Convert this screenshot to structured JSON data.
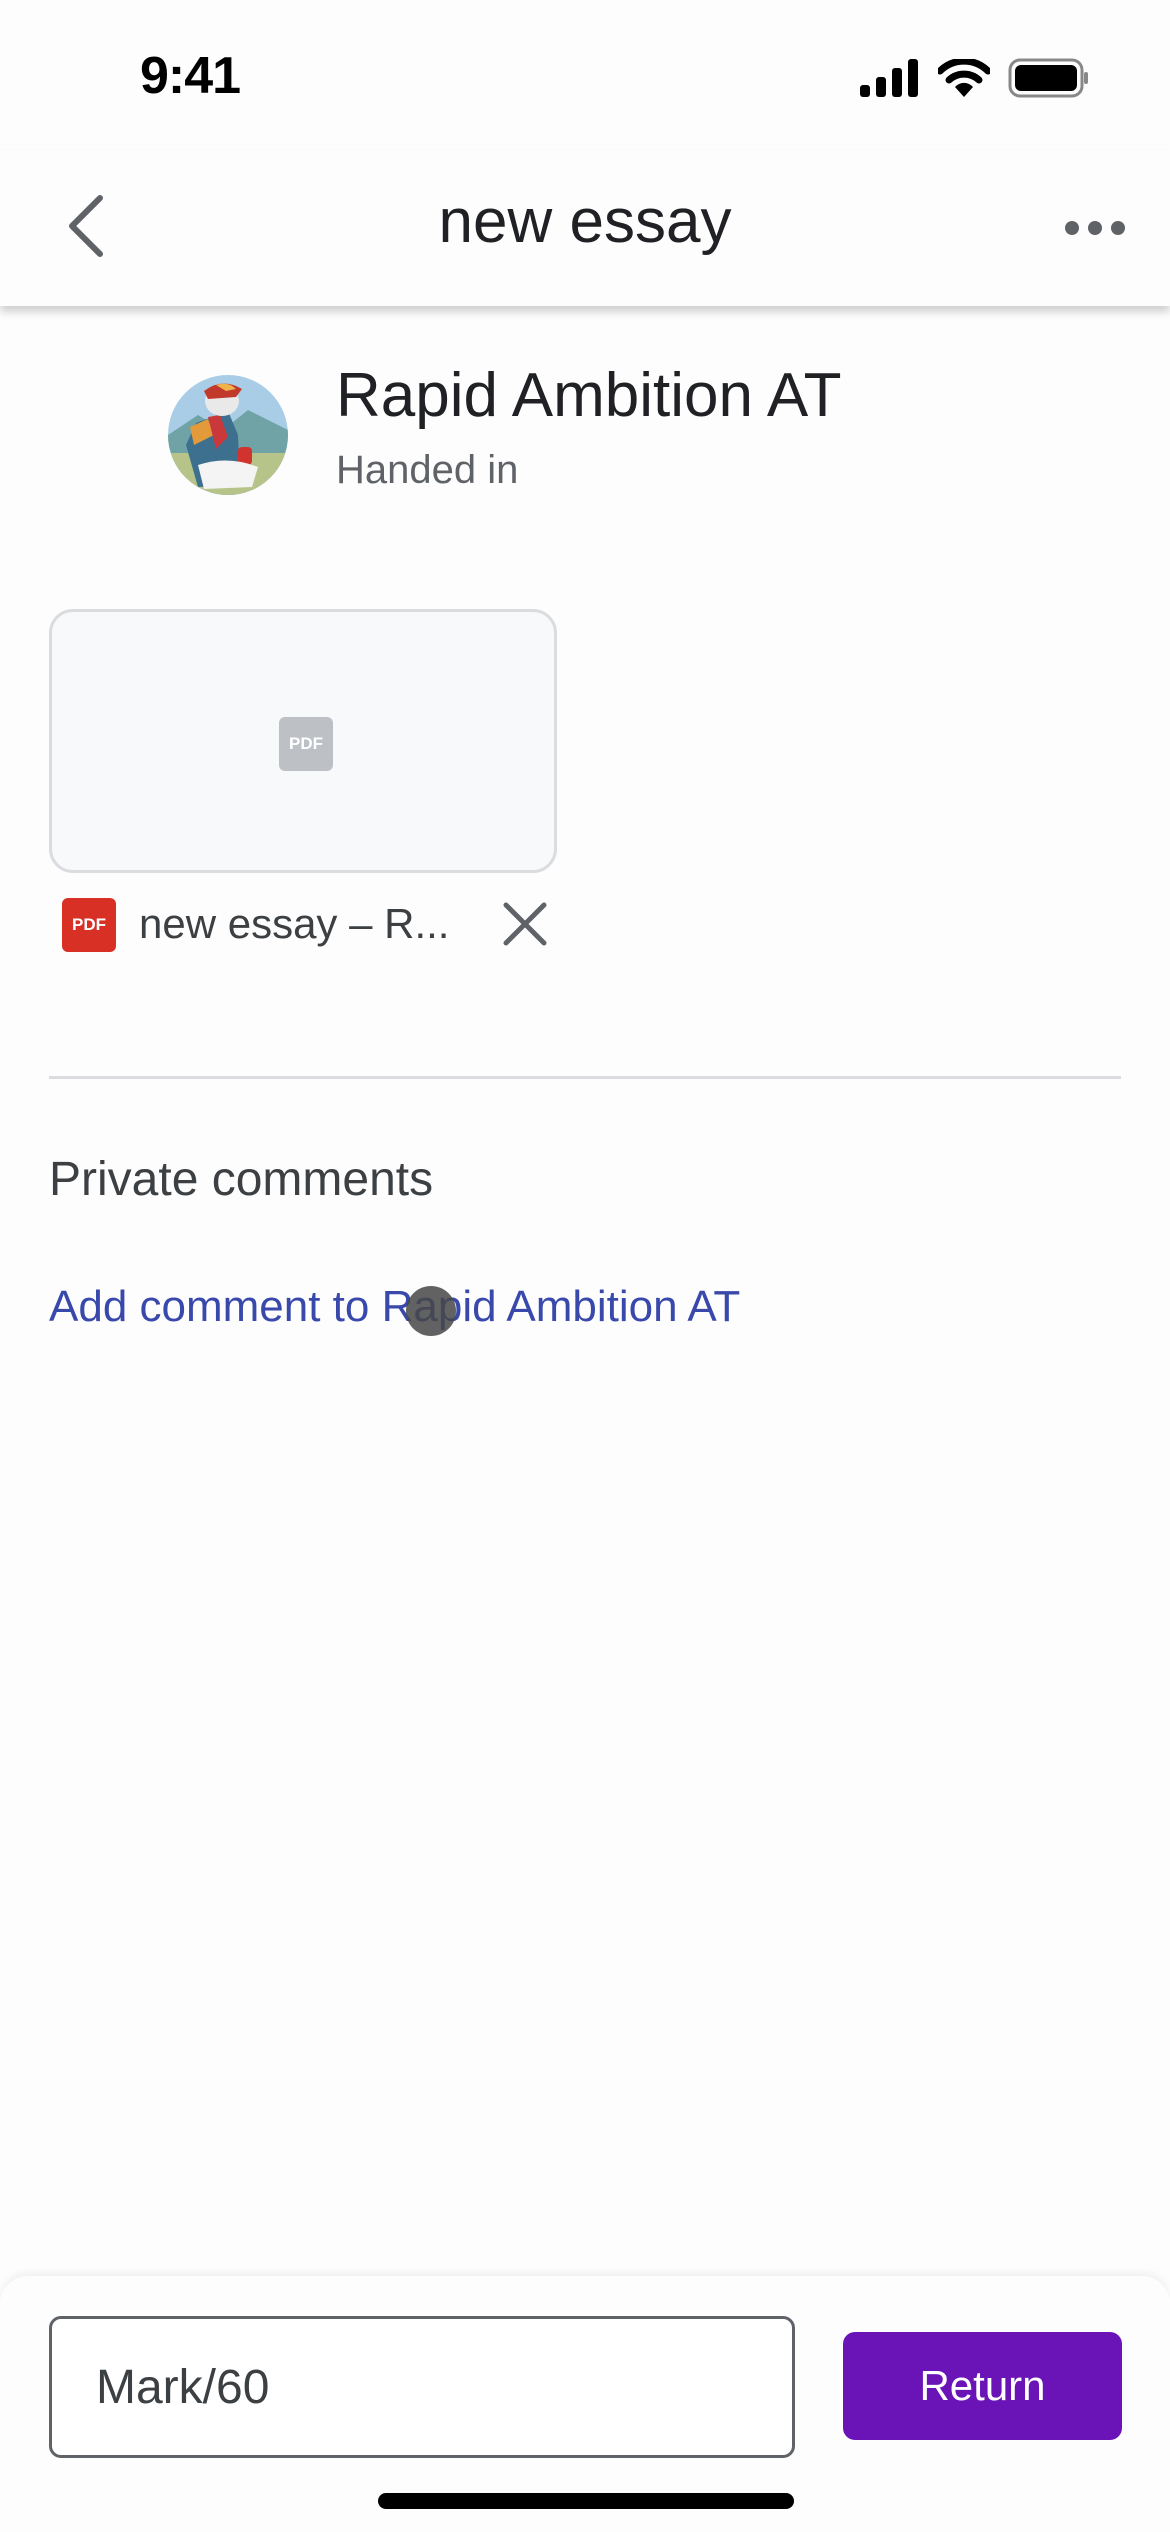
{
  "status_bar": {
    "time": "9:41",
    "icons": [
      "cellular-signal-icon",
      "wifi-icon",
      "battery-icon"
    ]
  },
  "nav": {
    "title": "new essay",
    "back_icon": "chevron-left-icon",
    "more_icon": "more-horizontal-icon"
  },
  "student": {
    "name": "Rapid Ambition AT",
    "status": "Handed in",
    "avatar_icon": "avatar-image"
  },
  "attachment": {
    "thumbnail_label": "PDF",
    "file_type_label": "PDF",
    "file_name": "new essay – R...",
    "remove_icon": "close-icon"
  },
  "comments": {
    "section_title": "Private comments",
    "add_comment_label": "Add comment to Rapid Ambition AT"
  },
  "grading": {
    "mark_placeholder": "Mark/60",
    "mark_value": "",
    "return_label": "Return"
  },
  "colors": {
    "accent_purple": "#6a14b8",
    "link_blue": "#3949ab",
    "pdf_red": "#d93025"
  }
}
